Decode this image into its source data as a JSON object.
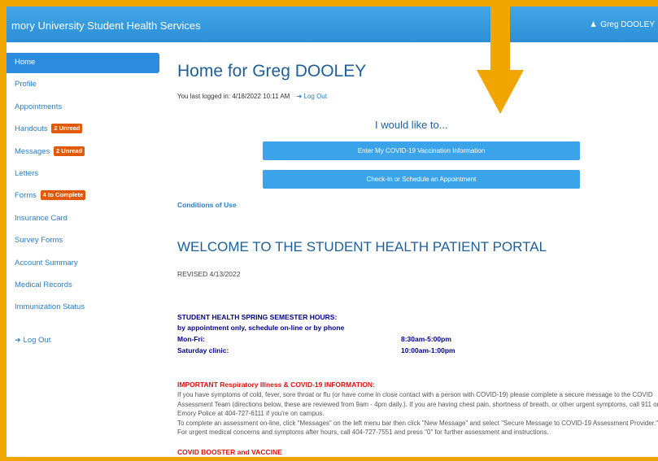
{
  "header": {
    "title": "mory University Student Health Services",
    "user_name": "Greg DOOLEY",
    "user_icon": "user-icon"
  },
  "sidebar": {
    "items": [
      {
        "label": "Home",
        "active": true
      },
      {
        "label": "Profile"
      },
      {
        "label": "Appointments"
      },
      {
        "label": "Handouts",
        "badge": "2 Unread"
      },
      {
        "label": "Messages",
        "badge": "2 Unread"
      },
      {
        "label": "Letters"
      },
      {
        "label": "Forms",
        "badge": "4 to Complete"
      },
      {
        "label": "Insurance Card"
      },
      {
        "label": "Survey Forms"
      },
      {
        "label": "Account Summary"
      },
      {
        "label": "Medical Records"
      },
      {
        "label": "Immunization Status"
      }
    ],
    "logout": "Log Out"
  },
  "main": {
    "title": "Home for Greg DOOLEY",
    "last_login": "You last logged in: 4/18/2022 10:11 AM",
    "logout_link": "Log Out",
    "would_like": "I would like to...",
    "button_covid": "Enter My COVID-19 Vaccination Information",
    "button_checkin": "Check-In or Schedule an Appointment",
    "conditions": "Conditions of Use",
    "welcome": "WELCOME TO THE STUDENT HEALTH PATIENT PORTAL",
    "revised": "REVISED 4/13/2022",
    "hours_title": "STUDENT HEALTH SPRING SEMESTER HOURS:",
    "hours_sub": "by appointment only, schedule on-line or by phone",
    "hours": [
      {
        "label": "Mon-Fri:",
        "value": "8:30am-5:00pm"
      },
      {
        "label": "Saturday clinic:",
        "value": "10:00am-1:00pm"
      }
    ],
    "important_title": "IMPORTANT Respiratory Illness & COVID-19 INFORMATION:",
    "important_p1": "If you have symptoms of cold, fever, sore throat or flu (or have come in close contact with a person with COVID-19) please complete a secure message to the COVID Assessment Team (directions below, these are reviewed from 9am - 4pm daily.). If you are having chest pain, shortness of breath, or other urgent symptoms, call 911 or Emory Police at 404-727-6111 if you're on campus.",
    "important_p2": "To complete an assessment on-line, click \"Messages\" on the left menu bar then click \"New Message\" and select \"Secure Message to COVID-19 Assessment Provider.\"",
    "important_p3": "For urgent medical concerns and symptoms after hours, call 404-727-7551 and press \"0\" for further assessment and instructions.",
    "covid_title": "COVID BOOSTER and VACCINE"
  },
  "colors": {
    "accent_border": "#f0a500",
    "topbar": "#2b8fd6",
    "link": "#2a7dc7",
    "badge": "#e05a0a",
    "heading": "#1e5f9a",
    "alert": "#e01010"
  }
}
